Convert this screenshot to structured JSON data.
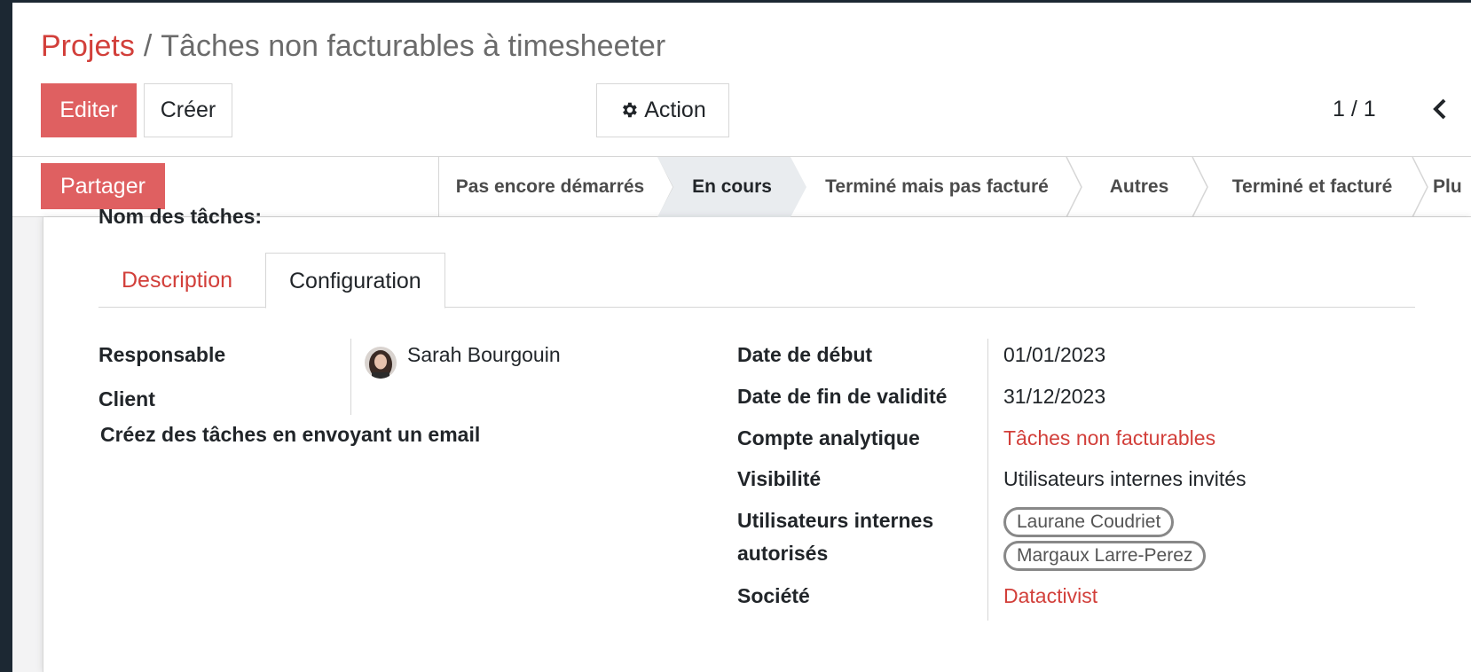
{
  "breadcrumb": {
    "parent": "Projets",
    "separator": "/",
    "current": "Tâches non facturables à timesheeter"
  },
  "toolbar": {
    "edit_label": "Editer",
    "create_label": "Créer",
    "action_label": "Action",
    "action_icon": "gear-icon",
    "pager": "1 / 1",
    "prev_icon": "chevron-left-icon"
  },
  "statusbar": {
    "share_label": "Partager",
    "stages": [
      {
        "label": "Pas encore démarrés"
      },
      {
        "label": "En cours",
        "active": true
      },
      {
        "label": "Terminé mais pas facturé"
      },
      {
        "label": "Autres"
      },
      {
        "label": "Terminé et facturé"
      },
      {
        "label": "Plu"
      }
    ]
  },
  "form": {
    "task_name_label": "Nom des tâches:",
    "tabs": [
      {
        "label": "Description"
      },
      {
        "label": "Configuration",
        "active": true
      }
    ],
    "left": {
      "responsable_label": "Responsable",
      "responsable_value": "Sarah Bourgouin",
      "client_label": "Client",
      "email_label": "Créez des tâches en envoyant un email"
    },
    "right": {
      "date_start_label": "Date de début",
      "date_start_value": "01/01/2023",
      "date_end_label": "Date de fin de validité",
      "date_end_value": "31/12/2023",
      "analytic_label": "Compte analytique",
      "analytic_value": "Tâches non facturables",
      "visibility_label": "Visibilité",
      "visibility_value": "Utilisateurs internes invités",
      "allowed_users_label_line1": "Utilisateurs internes",
      "allowed_users_label_line2": "autorisés",
      "allowed_users": [
        "Laurane Coudriet",
        "Margaux Larre-Perez"
      ],
      "company_label": "Société",
      "company_value": "Datactivist"
    }
  },
  "colors": {
    "accent": "#d23f3a",
    "primary_button": "#df6061",
    "active_stage": "#e9ecef"
  }
}
